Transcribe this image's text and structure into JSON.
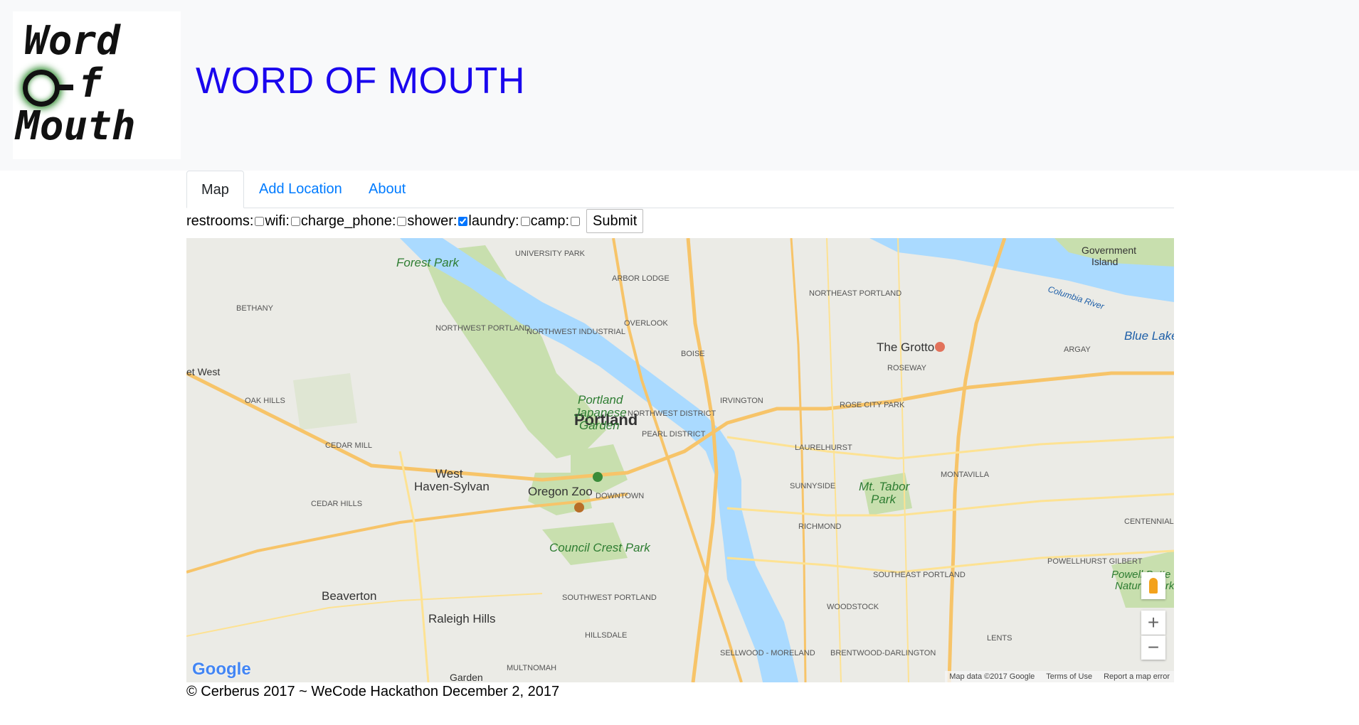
{
  "logo": {
    "line1": "Word",
    "line2": "f",
    "line3": "Mouth"
  },
  "site": {
    "title": "WORD OF MOUTH"
  },
  "tabs": [
    {
      "label": "Map",
      "active": true
    },
    {
      "label": "Add Location",
      "active": false
    },
    {
      "label": "About",
      "active": false
    }
  ],
  "filters": {
    "items": [
      {
        "label": "restrooms:",
        "checked": false
      },
      {
        "label": "wifi:",
        "checked": false
      },
      {
        "label": "charge_phone:",
        "checked": false
      },
      {
        "label": "shower:",
        "checked": true
      },
      {
        "label": "laundry:",
        "checked": false
      },
      {
        "label": "camp:",
        "checked": false
      }
    ],
    "submit_label": "Submit"
  },
  "map": {
    "google_logo": "Google",
    "attribution": {
      "data": "Map data ©2017 Google",
      "terms": "Terms of Use",
      "report": "Report a map error"
    },
    "zoom_in": "+",
    "zoom_out": "−",
    "labels": {
      "city": "Portland",
      "forest_park": "Forest Park",
      "japanese_garden_1": "Portland",
      "japanese_garden_2": "Japanese",
      "japanese_garden_3": "Garden",
      "oregon_zoo": "Oregon Zoo",
      "council_crest": "Council Crest Park",
      "mt_tabor_1": "Mt. Tabor",
      "mt_tabor_2": "Park",
      "the_grotto": "The Grotto",
      "beaverton": "Beaverton",
      "raleigh_hills": "Raleigh Hills",
      "west_haven_1": "West",
      "west_haven_2": "Haven-Sylvan",
      "government_island_1": "Government",
      "government_island_2": "Island",
      "blue_lake": "Blue Lake",
      "columbia_river": "Columbia River",
      "powell_butte_1": "Powell Butte",
      "powell_butte_2": "Natural Park",
      "garden": "Garden",
      "cedar_hills": "CEDAR HILLS",
      "cedar_mill": "CEDAR MILL",
      "oak_hills": "OAK HILLS",
      "bethany": "BETHANY",
      "downtown": "DOWNTOWN",
      "pearl_district": "PEARL DISTRICT",
      "northwest_district": "NORTHWEST DISTRICT",
      "irvington": "IRVINGTON",
      "laurelhurst": "LAURELHURST",
      "montavilla": "MONTAVILLA",
      "richmond": "RICHMOND",
      "sunnyside": "SUNNYSIDE",
      "rose_city_park": "ROSE CITY PARK",
      "roseway": "ROSEWAY",
      "argay": "ARGAY",
      "woodstock": "WOODSTOCK",
      "sellwood": "SELLWOOD - MORELAND",
      "brentwood": "BRENTWOOD-DARLINGTON",
      "lents": "LENTS",
      "multnomah": "MULTNOMAH",
      "hillsdale": "HILLSDALE",
      "overlook": "OVERLOOK",
      "boise": "BOISE",
      "arbor_lodge": "ARBOR LODGE",
      "university_park": "UNIVERSITY PARK",
      "southeast_portland": "SOUTHEAST PORTLAND",
      "southwest_portland": "SOUTHWEST PORTLAND",
      "northeast_portland": "NORTHEAST PORTLAND",
      "northwest_portland": "NORTHWEST PORTLAND",
      "northwest_industrial": "NORTHWEST INDUSTRIAL",
      "centennial": "CENTENNIAL",
      "powellhurst": "POWELLHURST GILBERT",
      "west_slope": "et West"
    }
  },
  "footer": {
    "text": "© Cerberus 2017 ~ WeCode Hackathon December 2, 2017"
  }
}
